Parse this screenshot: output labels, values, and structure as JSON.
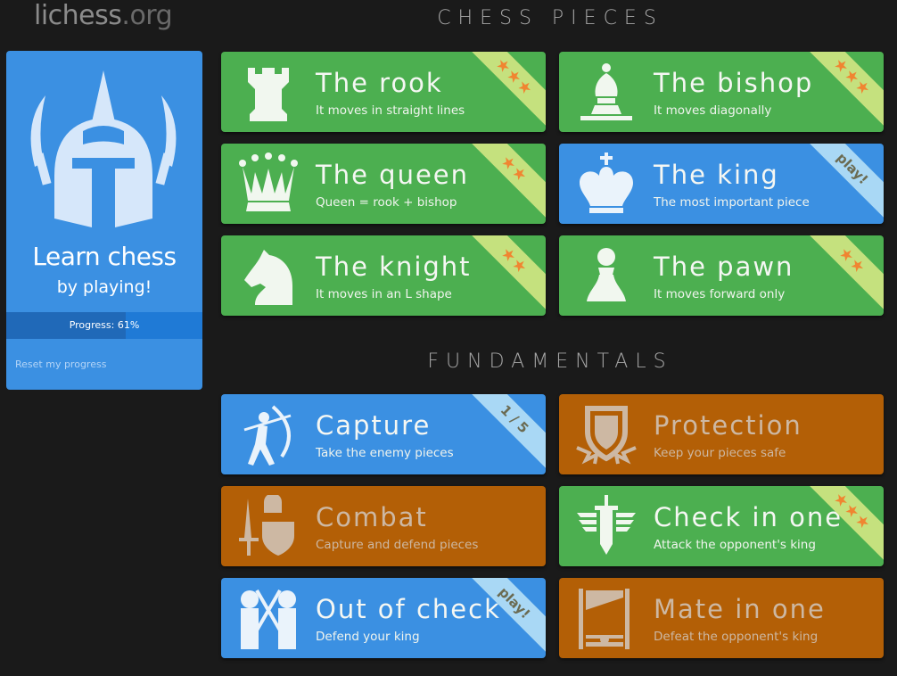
{
  "header": {
    "logo_main": "lichess",
    "logo_tld": ".org"
  },
  "sidebar": {
    "title": "Learn chess",
    "subtitle": "by playing!",
    "progress_label": "Progress: 61%",
    "progress_percent": 61,
    "reset_label": "Reset my progress",
    "icon": "helmet-icon"
  },
  "sections": [
    {
      "title": "CHESS PIECES",
      "cards": [
        {
          "title": "The rook",
          "desc": "It moves in straight lines",
          "color": "green",
          "badge": "★★★",
          "badge_type": "stars",
          "stars": 3,
          "icon": "rook-icon"
        },
        {
          "title": "The bishop",
          "desc": "It moves diagonally",
          "color": "green",
          "badge": "★★★",
          "badge_type": "stars",
          "stars": 3,
          "icon": "bishop-icon"
        },
        {
          "title": "The queen",
          "desc": "Queen = rook + bishop",
          "color": "green",
          "badge": "★★",
          "badge_type": "stars",
          "stars": 2,
          "icon": "queen-icon"
        },
        {
          "title": "The king",
          "desc": "The most important piece",
          "color": "blue",
          "badge": "play!",
          "badge_type": "text",
          "icon": "king-icon"
        },
        {
          "title": "The knight",
          "desc": "It moves in an L shape",
          "color": "green",
          "badge": "★★",
          "badge_type": "stars",
          "stars": 2,
          "icon": "knight-icon"
        },
        {
          "title": "The pawn",
          "desc": "It moves forward only",
          "color": "green",
          "badge": "★★",
          "badge_type": "stars",
          "stars": 2,
          "icon": "pawn-icon"
        }
      ]
    },
    {
      "title": "FUNDAMENTALS",
      "cards": [
        {
          "title": "Capture",
          "desc": "Take the enemy pieces",
          "color": "blue",
          "badge": "1 / 5",
          "badge_type": "text",
          "icon": "archer-icon"
        },
        {
          "title": "Protection",
          "desc": "Keep your pieces safe",
          "color": "orange",
          "badge": "",
          "badge_type": "none",
          "icon": "shield-icon"
        },
        {
          "title": "Combat",
          "desc": "Capture and defend pieces",
          "color": "orange",
          "badge": "",
          "badge_type": "none",
          "icon": "sword-shield-icon"
        },
        {
          "title": "Check in one",
          "desc": "Attack the opponent's king",
          "color": "green",
          "badge": "★★★",
          "badge_type": "stars",
          "stars": 3,
          "icon": "winged-sword-icon"
        },
        {
          "title": "Out of check",
          "desc": "Defend your king",
          "color": "blue",
          "badge": "play!",
          "badge_type": "text",
          "icon": "guards-icon"
        },
        {
          "title": "Mate in one",
          "desc": "Defeat the opponent's king",
          "color": "orange",
          "badge": "",
          "badge_type": "none",
          "icon": "guillotine-icon"
        }
      ]
    }
  ]
}
